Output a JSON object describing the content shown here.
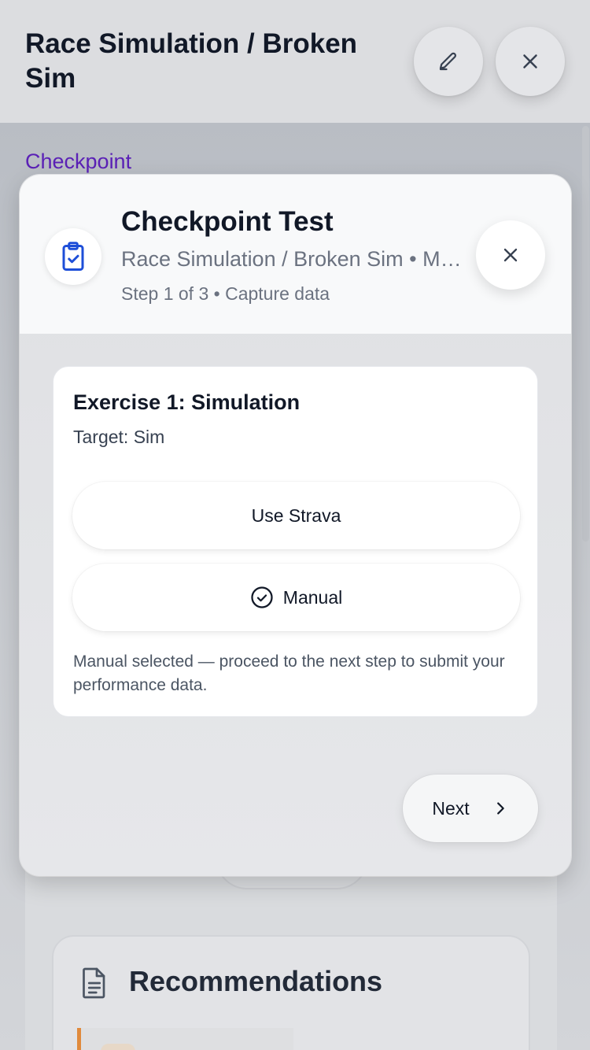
{
  "header": {
    "title": "Race Simulation / Broken Sim",
    "edit_icon": "pencil-icon",
    "close_icon": "close-icon"
  },
  "page": {
    "section_label": "Checkpoint",
    "recommendations_title": "Recommendations",
    "recommendations_icon": "document-icon"
  },
  "modal": {
    "icon": "clipboard-check-icon",
    "title": "Checkpoint Test",
    "subtitle": "Race Simulation / Broken Sim • Manual",
    "step": "Step 1 of 3 • Capture data",
    "close_icon": "close-icon",
    "exercise": {
      "title": "Exercise 1: Simulation",
      "target": "Target: Sim",
      "options": [
        {
          "label": "Use Strava",
          "selected": false
        },
        {
          "label": "Manual",
          "selected": true
        }
      ],
      "note": "Manual selected — proceed to the next step to submit your performance data."
    },
    "next_label": "Next"
  },
  "colors": {
    "accent": "#5b21b6",
    "icon_blue": "#1d4ed8",
    "warning": "#e08a3c"
  }
}
